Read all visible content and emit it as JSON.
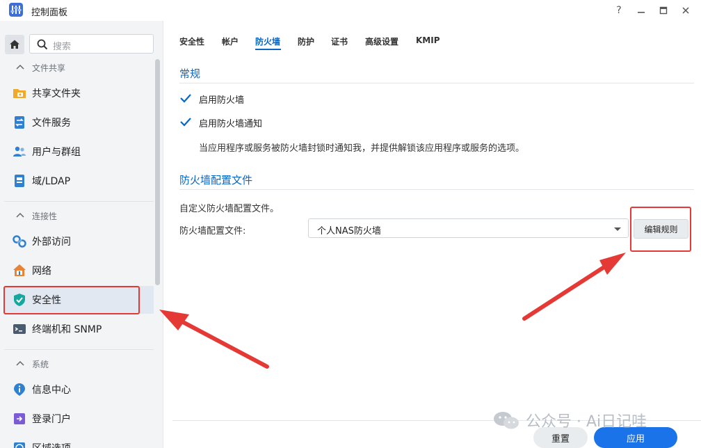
{
  "window": {
    "title": "控制面板",
    "controls": [
      "?",
      "–",
      "□",
      "✕"
    ]
  },
  "sidebar": {
    "search_placeholder": "搜索",
    "sections": [
      {
        "label": "文件共享"
      },
      {
        "label": "连接性"
      },
      {
        "label": "系统"
      }
    ],
    "items": [
      {
        "label": "共享文件夹",
        "icon": "shared-folder-icon"
      },
      {
        "label": "文件服务",
        "icon": "file-services-icon"
      },
      {
        "label": "用户与群组",
        "icon": "users-groups-icon"
      },
      {
        "label": "域/LDAP",
        "icon": "ldap-icon"
      },
      {
        "label": "外部访问",
        "icon": "external-access-icon"
      },
      {
        "label": "网络",
        "icon": "network-icon"
      },
      {
        "label": "安全性",
        "icon": "security-shield-icon",
        "active": true
      },
      {
        "label": "终端机和 SNMP",
        "icon": "terminal-icon"
      },
      {
        "label": "信息中心",
        "icon": "info-center-icon"
      },
      {
        "label": "登录门户",
        "icon": "login-portal-icon"
      },
      {
        "label": "区域选项",
        "icon": "regional-options-icon"
      }
    ]
  },
  "tabs": [
    {
      "label": "安全性"
    },
    {
      "label": "帐户"
    },
    {
      "label": "防火墙",
      "active": true
    },
    {
      "label": "防护"
    },
    {
      "label": "证书"
    },
    {
      "label": "高级设置"
    },
    {
      "label": "KMIP"
    }
  ],
  "general": {
    "title": "常规",
    "enable_firewall": {
      "label": "启用防火墙",
      "checked": true
    },
    "enable_notify": {
      "label": "启用防火墙通知",
      "checked": true
    },
    "notify_desc": "当应用程序或服务被防火墙封锁时通知我，并提供解锁该应用程序或服务的选项。"
  },
  "profile": {
    "title": "防火墙配置文件",
    "desc": "自定义防火墙配置文件。",
    "field_label": "防火墙配置文件:",
    "selected": "个人NAS防火墙",
    "edit_button": "编辑规则"
  },
  "footer": {
    "reset_button": "重置",
    "apply_button": "应用"
  },
  "watermark": "公众号 · Ai日记哇",
  "colors": {
    "accent": "#0a66c2",
    "apply": "#1a73e8",
    "annotation_red": "#e53935"
  }
}
